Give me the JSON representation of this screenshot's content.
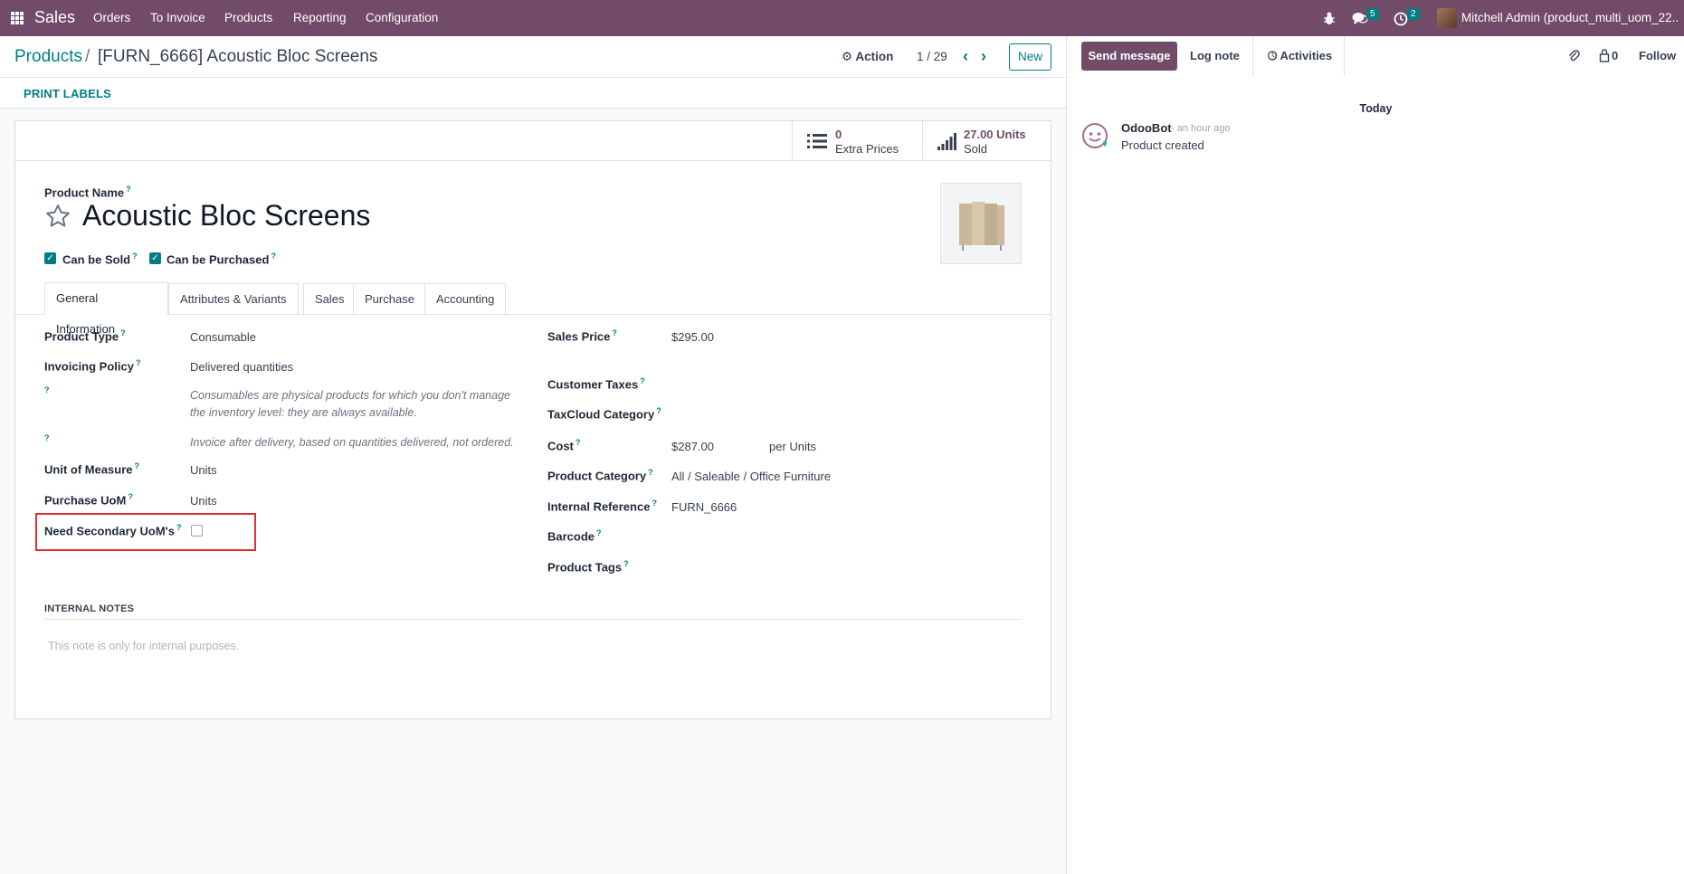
{
  "navbar": {
    "app_name": "Sales",
    "menu": [
      "Orders",
      "To Invoice",
      "Products",
      "Reporting",
      "Configuration"
    ],
    "messages_count": "5",
    "activities_count": "2",
    "user": "Mitchell Admin (product_multi_uom_22...",
    "bar_color": "#714B67"
  },
  "control": {
    "breadcrumb_root": "Products",
    "breadcrumb_sep": "/",
    "breadcrumb_current": "[FURN_6666] Acoustic Bloc Screens",
    "action_label": "Action",
    "pager": "1 / 29",
    "new_label": "New"
  },
  "actionbar": {
    "print_labels": "PRINT LABELS"
  },
  "smart_buttons": {
    "extra_prices": {
      "value": "0",
      "label": "Extra Prices"
    },
    "sold": {
      "value": "27.00 Units",
      "label": "Sold"
    }
  },
  "product": {
    "name_label": "Product Name",
    "name": "Acoustic Bloc Screens",
    "can_be_sold": "Can be Sold",
    "can_be_purchased": "Can be Purchased"
  },
  "tabs": [
    "General Information",
    "Attributes & Variants",
    "Sales",
    "Purchase",
    "Accounting"
  ],
  "general": {
    "product_type": {
      "label": "Product Type",
      "value": "Consumable"
    },
    "invoicing_policy": {
      "label": "Invoicing Policy",
      "value": "Delivered quantities"
    },
    "consumable_note": "Consumables are physical products for which you don't manage the inventory level: they are always available.",
    "invoice_note": "Invoice after delivery, based on quantities delivered, not ordered.",
    "uom": {
      "label": "Unit of Measure",
      "value": "Units"
    },
    "purchase_uom": {
      "label": "Purchase UoM",
      "value": "Units"
    },
    "secondary_uom": {
      "label": "Need Secondary UoM's",
      "checked": false
    },
    "sales_price": {
      "label": "Sales Price",
      "value": "$295.00"
    },
    "customer_taxes": {
      "label": "Customer Taxes",
      "value": ""
    },
    "taxcloud_category": {
      "label": "TaxCloud Category",
      "value": ""
    },
    "cost": {
      "label": "Cost",
      "value": "$287.00",
      "per": "per Units"
    },
    "product_category": {
      "label": "Product Category",
      "value": "All / Saleable / Office Furniture"
    },
    "internal_reference": {
      "label": "Internal Reference",
      "value": "FURN_6666"
    },
    "barcode": {
      "label": "Barcode",
      "value": ""
    },
    "product_tags": {
      "label": "Product Tags",
      "value": ""
    },
    "help_mark": "?"
  },
  "internal_notes": {
    "heading": "INTERNAL NOTES",
    "placeholder": "This note is only for internal purposes."
  },
  "chatter": {
    "send_message": "Send message",
    "log_note": "Log note",
    "activities": "Activities",
    "followers_count": "0",
    "follow": "Follow",
    "date_separator": "Today",
    "messages": [
      {
        "author": "OdooBot",
        "time": "- an hour ago",
        "body": "Product created"
      }
    ]
  },
  "highlight_color": "#e03131"
}
